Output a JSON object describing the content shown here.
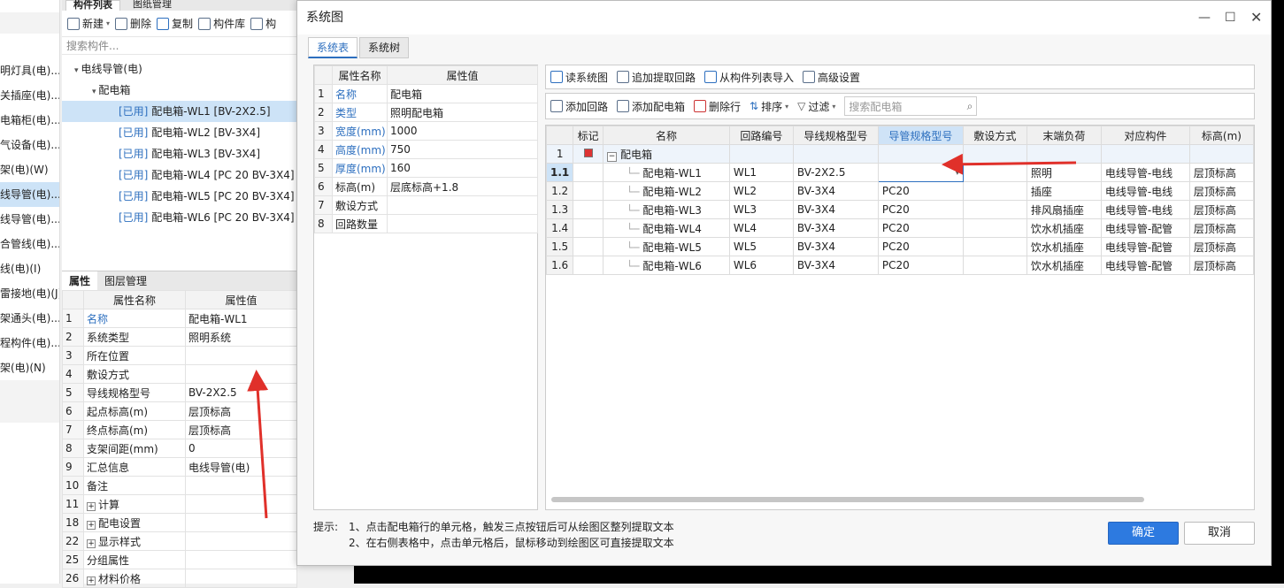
{
  "far_left_items": [
    "明灯具(电)...",
    "关插座(电)...",
    "电箱柜(电)...",
    "气设备(电)...",
    "架(电)(W)",
    "线导管(电)...",
    "线导管(电)...",
    "合管线(电)...",
    "线(电)(I)",
    "雷接地(电)(J)",
    "架通头(电)...",
    "程构件(电)...",
    "架(电)(N)"
  ],
  "left_panel": {
    "tabs": [
      "构件列表",
      "图纸管理"
    ],
    "toolbar": {
      "new": "新建",
      "delete": "删除",
      "copy": "复制",
      "library": "构件库",
      "more": "构"
    },
    "search_placeholder": "搜索构件...",
    "tree": {
      "root": "电线导管(电)",
      "child": "配电箱",
      "used_tag": "[已用]",
      "items": [
        "配电箱-WL1 [BV-2X2.5]",
        "配电箱-WL2 [BV-3X4]",
        "配电箱-WL3 [BV-3X4]",
        "配电箱-WL4 [PC 20 BV-3X4]",
        "配电箱-WL5 [PC 20 BV-3X4]",
        "配电箱-WL6 [PC 20 BV-3X4]"
      ]
    },
    "prop_tabs": [
      "属性",
      "图层管理"
    ],
    "prop_headers": [
      "属性名称",
      "属性值"
    ],
    "props": [
      {
        "n": "1",
        "name": "名称",
        "value": "配电箱-WL1"
      },
      {
        "n": "2",
        "name": "系统类型",
        "value": "照明系统"
      },
      {
        "n": "3",
        "name": "所在位置",
        "value": ""
      },
      {
        "n": "4",
        "name": "敷设方式",
        "value": ""
      },
      {
        "n": "5",
        "name": "导线规格型号",
        "value": "BV-2X2.5"
      },
      {
        "n": "6",
        "name": "起点标高(m)",
        "value": "层顶标高"
      },
      {
        "n": "7",
        "name": "终点标高(m)",
        "value": "层顶标高"
      },
      {
        "n": "8",
        "name": "支架间距(mm)",
        "value": "0"
      },
      {
        "n": "9",
        "name": "汇总信息",
        "value": "电线导管(电)"
      },
      {
        "n": "10",
        "name": "备注",
        "value": ""
      },
      {
        "n": "11",
        "name": "计算",
        "value": ""
      },
      {
        "n": "18",
        "name": "配电设置",
        "value": ""
      },
      {
        "n": "22",
        "name": "显示样式",
        "value": ""
      },
      {
        "n": "25",
        "name": "分组属性",
        "value": ""
      },
      {
        "n": "26",
        "name": "材料价格",
        "value": ""
      }
    ]
  },
  "dialog": {
    "title": "系统图",
    "tabs": [
      "系统表",
      "系统树"
    ],
    "left_headers": [
      "属性名称",
      "属性值"
    ],
    "left_props": [
      {
        "n": "1",
        "name": "名称",
        "value": "配电箱"
      },
      {
        "n": "2",
        "name": "类型",
        "value": "照明配电箱"
      },
      {
        "n": "3",
        "name": "宽度(mm)",
        "value": "1000"
      },
      {
        "n": "4",
        "name": "高度(mm)",
        "value": "750"
      },
      {
        "n": "5",
        "name": "厚度(mm)",
        "value": "160"
      },
      {
        "n": "6",
        "name": "标高(m)",
        "value": "层底标高+1.8"
      },
      {
        "n": "7",
        "name": "敷设方式",
        "value": ""
      },
      {
        "n": "8",
        "name": "回路数量",
        "value": ""
      }
    ],
    "toolbar1": {
      "read": "读系统图",
      "append": "追加提取回路",
      "import": "从构件列表导入",
      "advanced": "高级设置"
    },
    "toolbar2": {
      "add_circuit": "添加回路",
      "add_box": "添加配电箱",
      "delete_row": "删除行",
      "sort": "排序",
      "filter": "过滤",
      "search_placeholder": "搜索配电箱"
    },
    "grid_headers": [
      "标记",
      "名称",
      "回路编号",
      "导线规格型号",
      "导管规格型号",
      "敷设方式",
      "末端负荷",
      "对应构件",
      "标高(m)"
    ],
    "group_row": {
      "n": "1",
      "name": "配电箱"
    },
    "rows": [
      {
        "n": "1.1",
        "name": "配电箱-WL1",
        "circuit": "WL1",
        "wire": "BV-2X2.5",
        "conduit": "",
        "laying": "",
        "load": "照明",
        "comp": "电线导管-电线",
        "elev": "层顶标高"
      },
      {
        "n": "1.2",
        "name": "配电箱-WL2",
        "circuit": "WL2",
        "wire": "BV-3X4",
        "conduit": "PC20",
        "laying": "",
        "load": "插座",
        "comp": "电线导管-电线",
        "elev": "层顶标高"
      },
      {
        "n": "1.3",
        "name": "配电箱-WL3",
        "circuit": "WL3",
        "wire": "BV-3X4",
        "conduit": "PC20",
        "laying": "",
        "load": "排风扇插座",
        "comp": "电线导管-电线",
        "elev": "层顶标高"
      },
      {
        "n": "1.4",
        "name": "配电箱-WL4",
        "circuit": "WL4",
        "wire": "BV-3X4",
        "conduit": "PC20",
        "laying": "",
        "load": "饮水机插座",
        "comp": "电线导管-配管",
        "elev": "层顶标高"
      },
      {
        "n": "1.5",
        "name": "配电箱-WL5",
        "circuit": "WL5",
        "wire": "BV-3X4",
        "conduit": "PC20",
        "laying": "",
        "load": "饮水机插座",
        "comp": "电线导管-配管",
        "elev": "层顶标高"
      },
      {
        "n": "1.6",
        "name": "配电箱-WL6",
        "circuit": "WL6",
        "wire": "BV-3X4",
        "conduit": "PC20",
        "laying": "",
        "load": "饮水机插座",
        "comp": "电线导管-配管",
        "elev": "层顶标高"
      }
    ],
    "hint_label": "提示:",
    "hint1": "1、点击配电箱行的单元格，触发三点按钮后可从绘图区整列提取文本",
    "hint2": "2、在右侧表格中，点击单元格后，鼠标移动到绘图区可直接提取文本",
    "ok": "确定",
    "cancel": "取消"
  },
  "colors": {
    "accent": "#2d6fbf",
    "primary_button": "#2d7ae0",
    "arrow": "#e0302a"
  }
}
